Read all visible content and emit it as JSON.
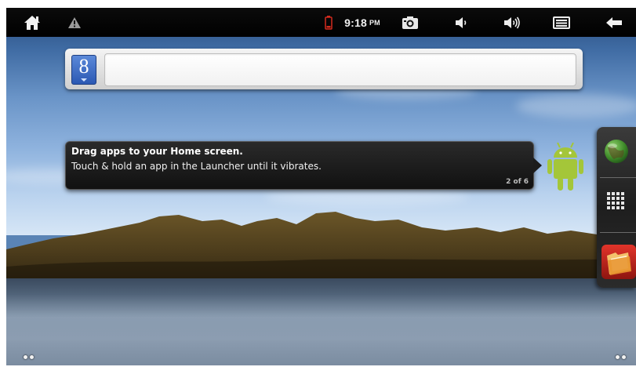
{
  "statusbar": {
    "time": "9:18",
    "ampm": "PM",
    "icons": [
      "home-icon",
      "warning-icon",
      "battery-low-icon",
      "screenshot-icon",
      "volume-down-icon",
      "volume-up-icon",
      "menu-icon",
      "back-icon"
    ]
  },
  "search": {
    "button_label": "8",
    "placeholder": ""
  },
  "tooltip": {
    "title": "Drag apps to your Home screen.",
    "body": "Touch & hold an app in the Launcher until it vibrates.",
    "page": "2 of 6"
  },
  "dock": {
    "items": [
      "browser-globe-icon",
      "app-launcher-grid-icon",
      "gallery-folder-icon"
    ]
  },
  "colors": {
    "statusbar": "#000000",
    "tooltip_bg": "#1a1a1a",
    "android_green": "#a4c639",
    "search_blue": "#3a6fd1"
  }
}
